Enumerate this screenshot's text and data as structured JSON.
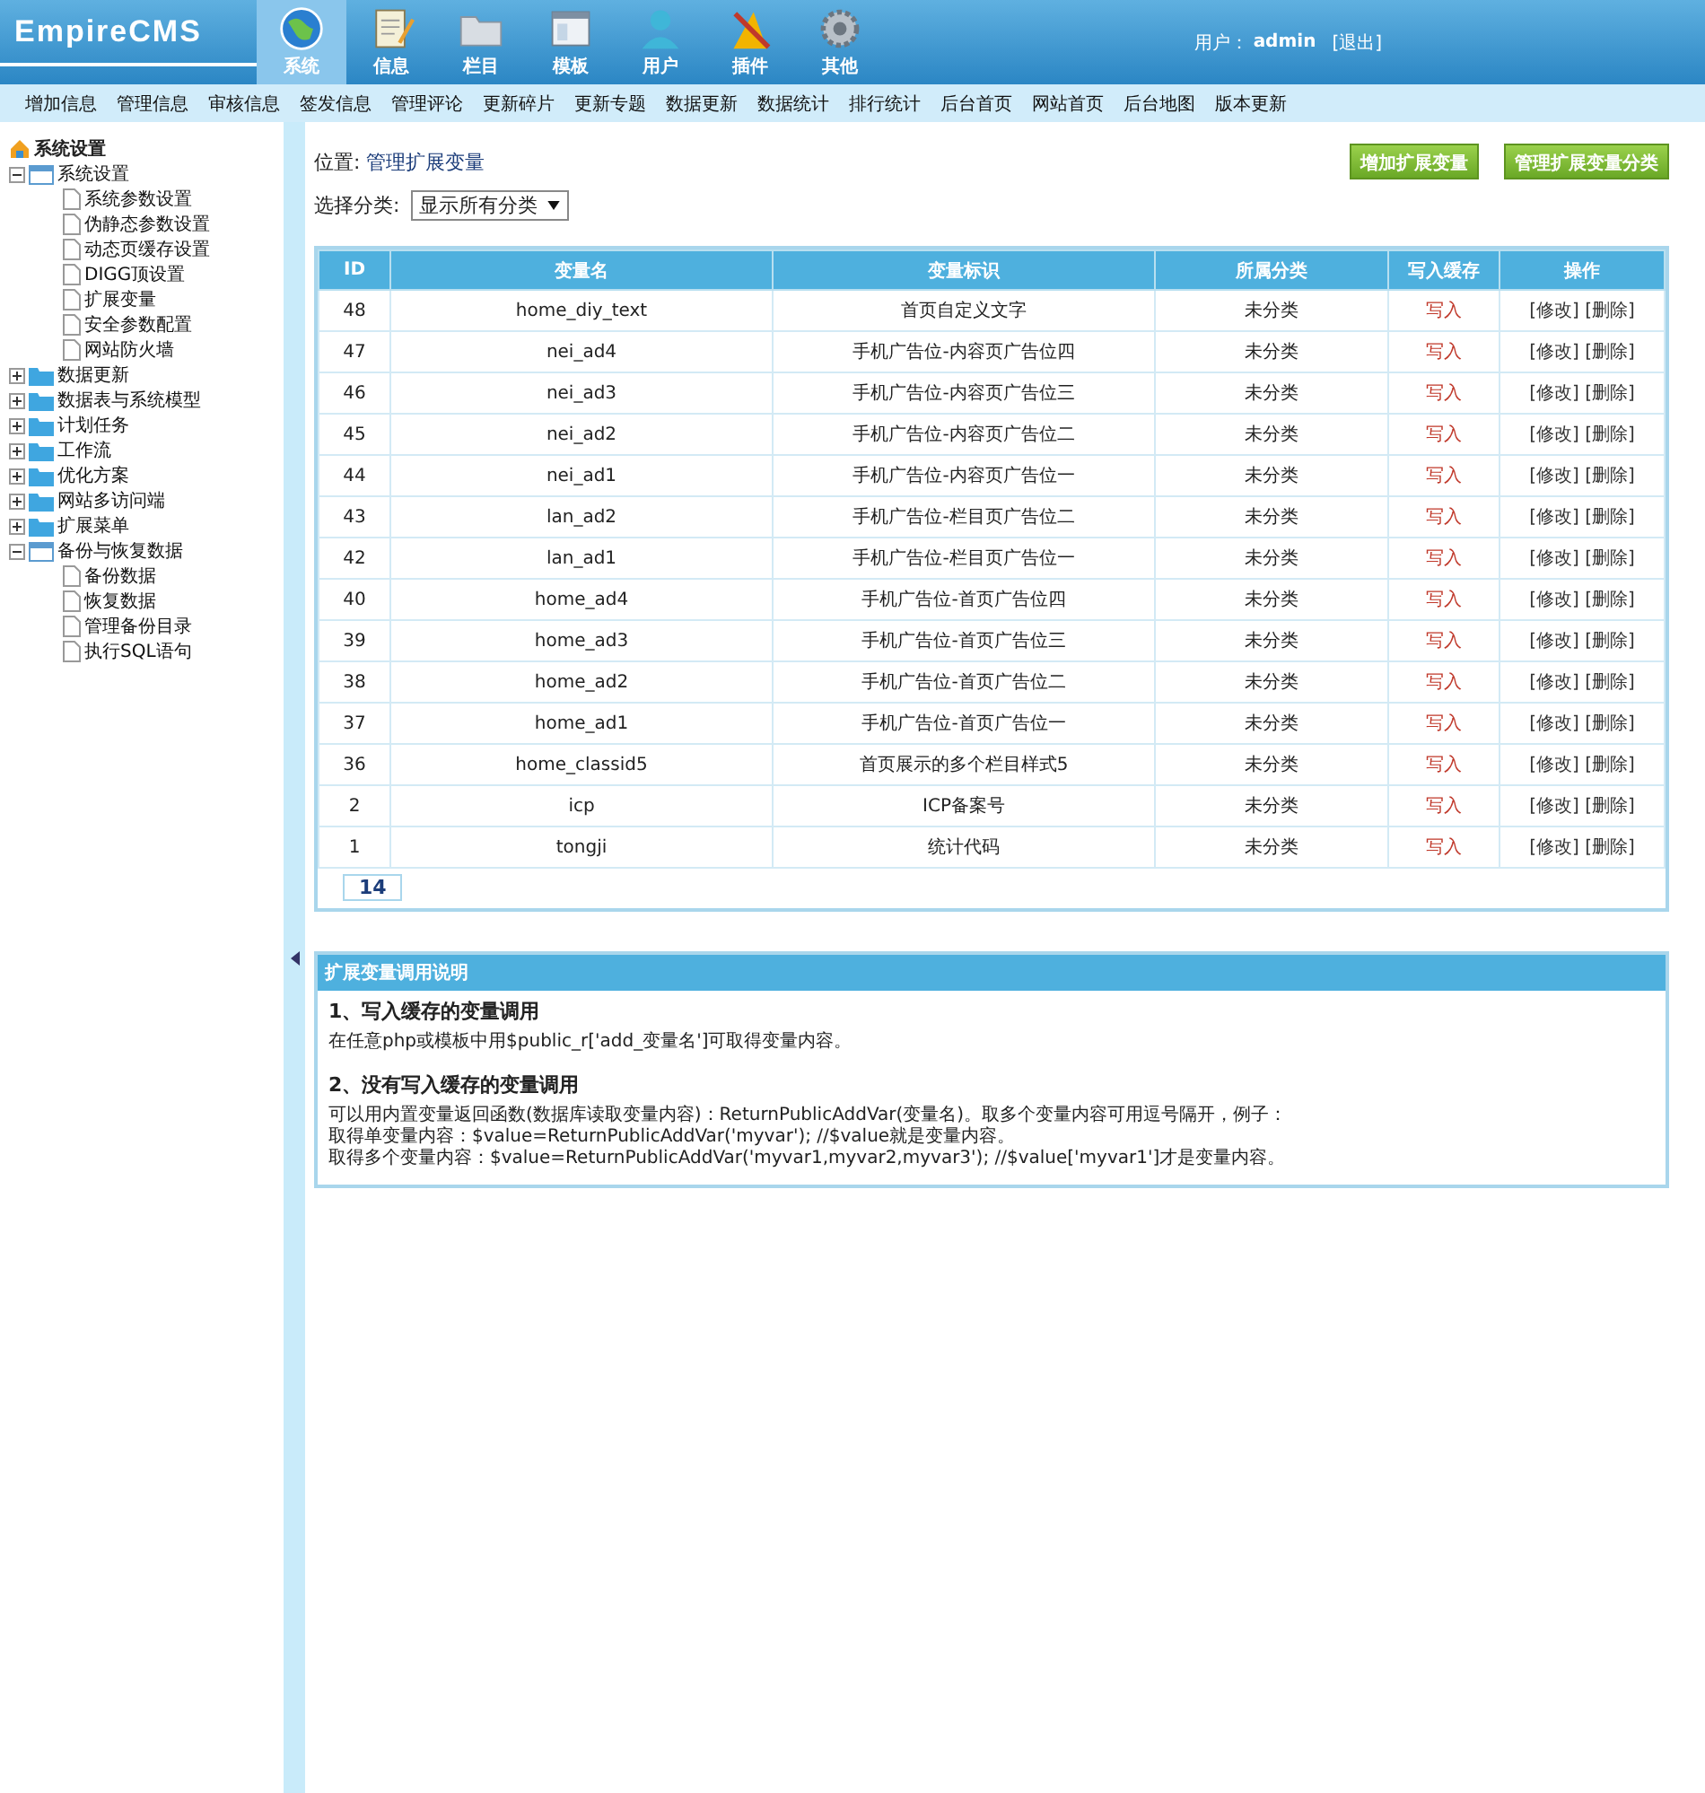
{
  "header": {
    "logo": "EmpireCMS",
    "nav": [
      {
        "label": "系统",
        "kind": "globe",
        "selected": true
      },
      {
        "label": "信息",
        "kind": "notepad",
        "selected": false
      },
      {
        "label": "栏目",
        "kind": "folder",
        "selected": false
      },
      {
        "label": "模板",
        "kind": "window",
        "selected": false
      },
      {
        "label": "用户",
        "kind": "user",
        "selected": false
      },
      {
        "label": "插件",
        "kind": "tools",
        "selected": false
      },
      {
        "label": "其他",
        "kind": "gear",
        "selected": false
      }
    ],
    "user_label": "用户：",
    "user": "admin",
    "logout": "[退出]"
  },
  "menu": [
    "增加信息",
    "管理信息",
    "审核信息",
    "签发信息",
    "管理评论",
    "更新碎片",
    "更新专题",
    "数据更新",
    "数据统计",
    "排行统计",
    "后台首页",
    "网站首页",
    "后台地图",
    "版本更新"
  ],
  "sidebar": {
    "title": "系统设置",
    "tree": [
      {
        "label": "系统设置",
        "expanded": true,
        "children": [
          {
            "label": "系统参数设置"
          },
          {
            "label": "伪静态参数设置"
          },
          {
            "label": "动态页缓存设置"
          },
          {
            "label": "DIGG顶设置"
          },
          {
            "label": "扩展变量"
          },
          {
            "label": "安全参数配置"
          },
          {
            "label": "网站防火墙"
          }
        ]
      },
      {
        "label": "数据更新",
        "expanded": false
      },
      {
        "label": "数据表与系统模型",
        "expanded": false
      },
      {
        "label": "计划任务",
        "expanded": false
      },
      {
        "label": "工作流",
        "expanded": false
      },
      {
        "label": "优化方案",
        "expanded": false
      },
      {
        "label": "网站多访问端",
        "expanded": false
      },
      {
        "label": "扩展菜单",
        "expanded": false
      },
      {
        "label": "备份与恢复数据",
        "expanded": true,
        "children": [
          {
            "label": "备份数据"
          },
          {
            "label": "恢复数据"
          },
          {
            "label": "管理备份目录"
          },
          {
            "label": "执行SQL语句"
          }
        ]
      }
    ]
  },
  "breadcrumb": {
    "label": "位置:",
    "link": "管理扩展变量"
  },
  "buttons": [
    "增加扩展变量",
    "管理扩展变量分类"
  ],
  "filter": {
    "label": "选择分类:",
    "value": "显示所有分类"
  },
  "table": {
    "columns": [
      "ID",
      "变量名",
      "变量标识",
      "所属分类",
      "写入缓存",
      "操作"
    ],
    "rows": [
      {
        "id": "48",
        "name": "home_diy_text",
        "label": "首页自定义文字",
        "category": "未分类",
        "write": "写入",
        "edit": "[修改]",
        "delete": "[删除]"
      },
      {
        "id": "47",
        "name": "nei_ad4",
        "label": "手机广告位-内容页广告位四",
        "category": "未分类",
        "write": "写入",
        "edit": "[修改]",
        "delete": "[删除]"
      },
      {
        "id": "46",
        "name": "nei_ad3",
        "label": "手机广告位-内容页广告位三",
        "category": "未分类",
        "write": "写入",
        "edit": "[修改]",
        "delete": "[删除]"
      },
      {
        "id": "45",
        "name": "nei_ad2",
        "label": "手机广告位-内容页广告位二",
        "category": "未分类",
        "write": "写入",
        "edit": "[修改]",
        "delete": "[删除]"
      },
      {
        "id": "44",
        "name": "nei_ad1",
        "label": "手机广告位-内容页广告位一",
        "category": "未分类",
        "write": "写入",
        "edit": "[修改]",
        "delete": "[删除]"
      },
      {
        "id": "43",
        "name": "lan_ad2",
        "label": "手机广告位-栏目页广告位二",
        "category": "未分类",
        "write": "写入",
        "edit": "[修改]",
        "delete": "[删除]"
      },
      {
        "id": "42",
        "name": "lan_ad1",
        "label": "手机广告位-栏目页广告位一",
        "category": "未分类",
        "write": "写入",
        "edit": "[修改]",
        "delete": "[删除]"
      },
      {
        "id": "40",
        "name": "home_ad4",
        "label": "手机广告位-首页广告位四",
        "category": "未分类",
        "write": "写入",
        "edit": "[修改]",
        "delete": "[删除]"
      },
      {
        "id": "39",
        "name": "home_ad3",
        "label": "手机广告位-首页广告位三",
        "category": "未分类",
        "write": "写入",
        "edit": "[修改]",
        "delete": "[删除]"
      },
      {
        "id": "38",
        "name": "home_ad2",
        "label": "手机广告位-首页广告位二",
        "category": "未分类",
        "write": "写入",
        "edit": "[修改]",
        "delete": "[删除]"
      },
      {
        "id": "37",
        "name": "home_ad1",
        "label": "手机广告位-首页广告位一",
        "category": "未分类",
        "write": "写入",
        "edit": "[修改]",
        "delete": "[删除]"
      },
      {
        "id": "36",
        "name": "home_classid5",
        "label": "首页展示的多个栏目样式5",
        "category": "未分类",
        "write": "写入",
        "edit": "[修改]",
        "delete": "[删除]"
      },
      {
        "id": "2",
        "name": "icp",
        "label": "ICP备案号",
        "category": "未分类",
        "write": "写入",
        "edit": "[修改]",
        "delete": "[删除]"
      },
      {
        "id": "1",
        "name": "tongji",
        "label": "统计代码",
        "category": "未分类",
        "write": "写入",
        "edit": "[修改]",
        "delete": "[删除]"
      }
    ],
    "pager": "14"
  },
  "help": {
    "title": "扩展变量调用说明",
    "sections": [
      {
        "heading": "1、写入缓存的变量调用",
        "lines": [
          "在任意php或模板中用$public_r['add_变量名']可取得变量内容。"
        ]
      },
      {
        "heading": "2、没有写入缓存的变量调用",
        "lines": [
          "可以用内置变量返回函数(数据库读取变量内容)：ReturnPublicAddVar(变量名)。取多个变量内容可用逗号隔开，例子：",
          "取得单变量内容：$value=ReturnPublicAddVar('myvar'); //$value就是变量内容。",
          "取得多个变量内容：$value=ReturnPublicAddVar('myvar1,myvar2,myvar3'); //$value['myvar1']才是变量内容。"
        ]
      }
    ]
  }
}
